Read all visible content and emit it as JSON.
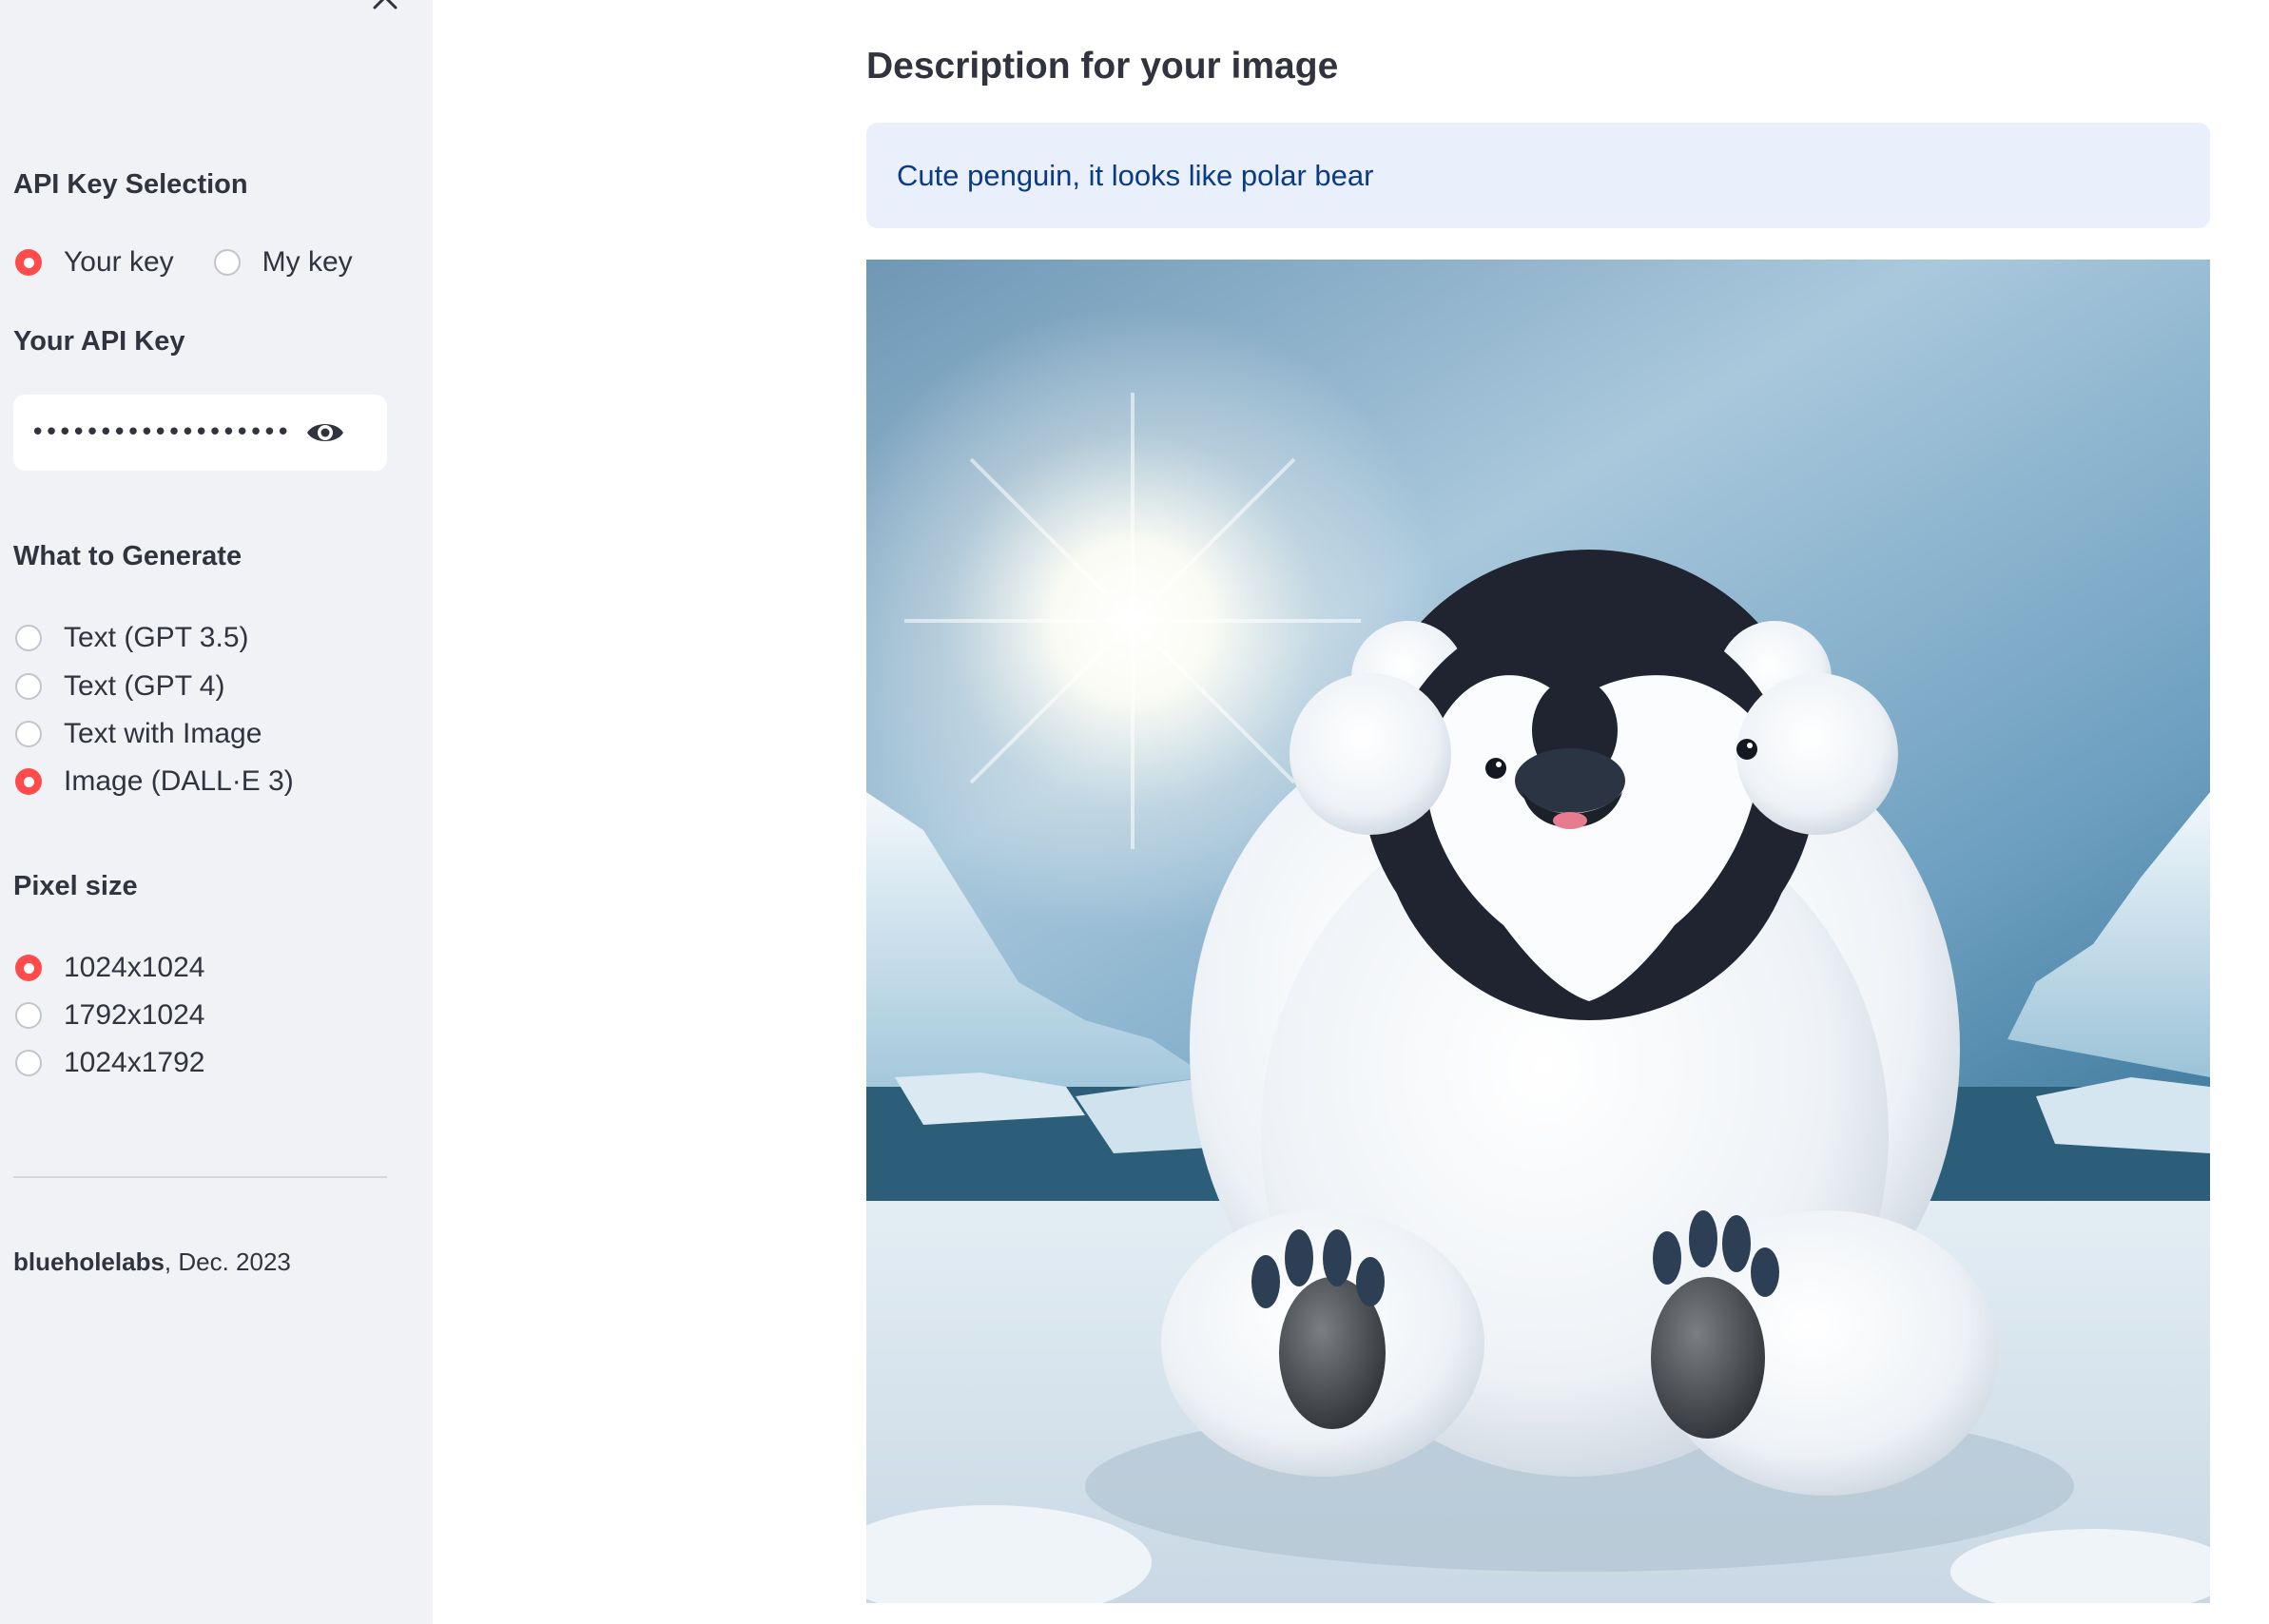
{
  "sidebar": {
    "api_key_section": {
      "heading": "API Key Selection",
      "options": [
        {
          "label": "Your key",
          "checked": true
        },
        {
          "label": "My key",
          "checked": false
        }
      ]
    },
    "api_key_field": {
      "label": "Your API Key",
      "masked_value": "••••••••••••••••••••••••••••••••"
    },
    "generate_section": {
      "heading": "What to Generate",
      "options": [
        {
          "label": "Text (GPT 3.5)",
          "checked": false
        },
        {
          "label": "Text (GPT 4)",
          "checked": false
        },
        {
          "label": "Text with Image",
          "checked": false
        },
        {
          "label": "Image (DALL·E 3)",
          "checked": true
        }
      ]
    },
    "pixel_section": {
      "heading": "Pixel size",
      "options": [
        {
          "label": "1024x1024",
          "checked": true
        },
        {
          "label": "1792x1024",
          "checked": false
        },
        {
          "label": "1024x1792",
          "checked": false
        }
      ]
    },
    "footer": {
      "author": "blueholelabs",
      "date": ", Dec. 2023"
    }
  },
  "main": {
    "heading": "Description for your image",
    "description": "Cute penguin, it looks like polar bear",
    "generated_image": "penguin-polar-bear-image"
  },
  "colors": {
    "accent": "#ff4b4b",
    "sidebar_bg": "#f0f2f6",
    "info_bg": "#e9f0fb",
    "info_text": "#0b3b86",
    "text": "#31333f"
  }
}
